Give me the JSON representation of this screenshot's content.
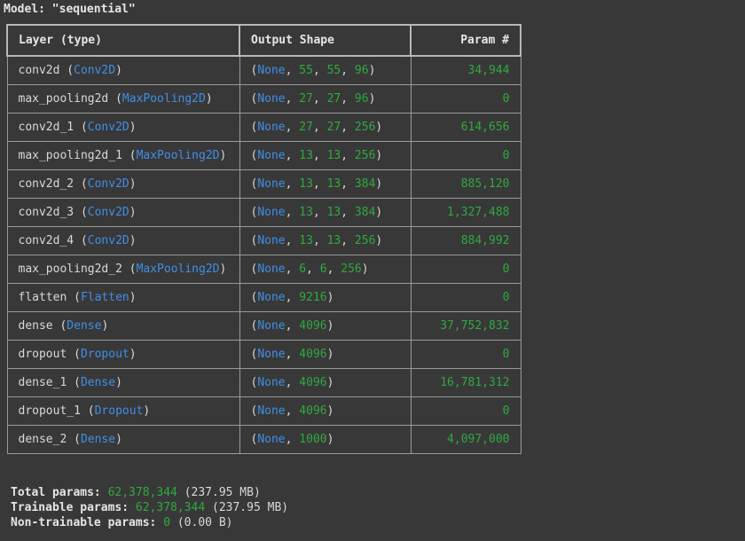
{
  "model_title": "Model: \"sequential\"",
  "headers": {
    "layer": "Layer (type)",
    "shape": "Output Shape",
    "params": "Param #"
  },
  "rows": [
    {
      "name": "conv2d",
      "type": "Conv2D",
      "shape": [
        "None",
        "55",
        "55",
        "96"
      ],
      "params": "34,944"
    },
    {
      "name": "max_pooling2d",
      "type": "MaxPooling2D",
      "shape": [
        "None",
        "27",
        "27",
        "96"
      ],
      "params": "0"
    },
    {
      "name": "conv2d_1",
      "type": "Conv2D",
      "shape": [
        "None",
        "27",
        "27",
        "256"
      ],
      "params": "614,656"
    },
    {
      "name": "max_pooling2d_1",
      "type": "MaxPooling2D",
      "shape": [
        "None",
        "13",
        "13",
        "256"
      ],
      "params": "0"
    },
    {
      "name": "conv2d_2",
      "type": "Conv2D",
      "shape": [
        "None",
        "13",
        "13",
        "384"
      ],
      "params": "885,120"
    },
    {
      "name": "conv2d_3",
      "type": "Conv2D",
      "shape": [
        "None",
        "13",
        "13",
        "384"
      ],
      "params": "1,327,488"
    },
    {
      "name": "conv2d_4",
      "type": "Conv2D",
      "shape": [
        "None",
        "13",
        "13",
        "256"
      ],
      "params": "884,992"
    },
    {
      "name": "max_pooling2d_2",
      "type": "MaxPooling2D",
      "shape": [
        "None",
        "6",
        "6",
        "256"
      ],
      "params": "0"
    },
    {
      "name": "flatten",
      "type": "Flatten",
      "shape": [
        "None",
        "9216"
      ],
      "params": "0"
    },
    {
      "name": "dense",
      "type": "Dense",
      "shape": [
        "None",
        "4096"
      ],
      "params": "37,752,832"
    },
    {
      "name": "dropout",
      "type": "Dropout",
      "shape": [
        "None",
        "4096"
      ],
      "params": "0"
    },
    {
      "name": "dense_1",
      "type": "Dense",
      "shape": [
        "None",
        "4096"
      ],
      "params": "16,781,312"
    },
    {
      "name": "dropout_1",
      "type": "Dropout",
      "shape": [
        "None",
        "4096"
      ],
      "params": "0"
    },
    {
      "name": "dense_2",
      "type": "Dense",
      "shape": [
        "None",
        "1000"
      ],
      "params": "4,097,000"
    }
  ],
  "footer": {
    "total": {
      "label": "Total params:",
      "value": "62,378,344",
      "size": "(237.95 MB)"
    },
    "trainable": {
      "label": "Trainable params:",
      "value": "62,378,344",
      "size": "(237.95 MB)"
    },
    "non_trainable": {
      "label": "Non-trainable params:",
      "value": "0",
      "size": "(0.00 B)"
    }
  },
  "colors": {
    "background": "#383838",
    "type_blue": "#3f8fe6",
    "number_green": "#2faa3f"
  }
}
